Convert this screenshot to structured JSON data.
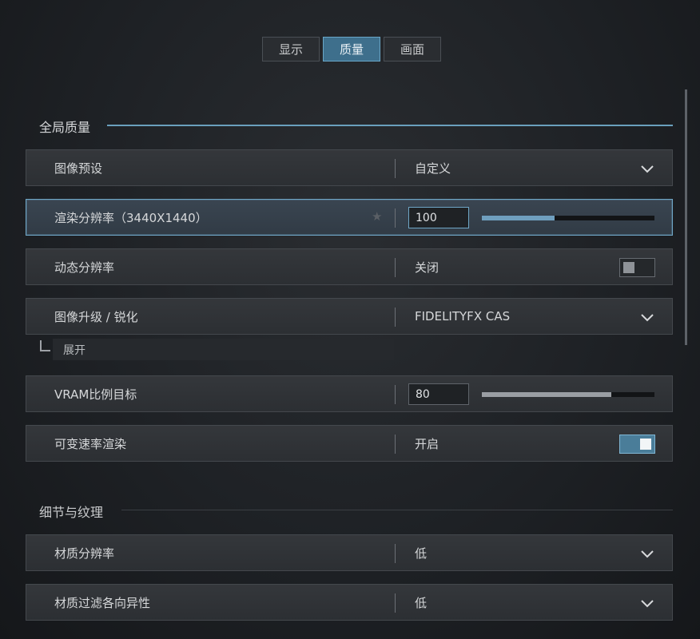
{
  "tabs": [
    {
      "label": "显示",
      "active": false
    },
    {
      "label": "质量",
      "active": true
    },
    {
      "label": "画面",
      "active": false
    }
  ],
  "sections": {
    "global_quality": {
      "title": "全局质量"
    },
    "detail_texture": {
      "title": "细节与纹理"
    }
  },
  "rows": {
    "image_preset": {
      "label": "图像预设",
      "value": "自定义",
      "control": "dropdown"
    },
    "render_resolution": {
      "label": "渲染分辨率（3440X1440）",
      "value": "100",
      "slider_fraction": 0.42,
      "control": "slider",
      "selected": true
    },
    "dynamic_resolution": {
      "label": "动态分辨率",
      "value": "关闭",
      "control": "toggle",
      "toggle_on": false
    },
    "upscaling": {
      "label": "图像升级 / 锐化",
      "value": "FIDELITYFX CAS",
      "control": "dropdown"
    },
    "upscaling_expand": {
      "label": "展开"
    },
    "vram_target": {
      "label": "VRAM比例目标",
      "value": "80",
      "slider_fraction": 0.75,
      "control": "slider"
    },
    "vrs": {
      "label": "可变速率渲染",
      "value": "开启",
      "control": "toggle",
      "toggle_on": true
    },
    "texture_resolution": {
      "label": "材质分辨率",
      "value": "低",
      "control": "dropdown"
    },
    "texture_filtering": {
      "label": "材质过滤各向异性",
      "value": "低",
      "control": "dropdown"
    }
  },
  "icons": {
    "chevron": "chevron-down-icon",
    "star": "star-icon",
    "branch": "tree-branch-icon"
  },
  "colors": {
    "accent": "#6aa0bd",
    "active_tab": "#3e6f8c",
    "slider_fill_active": "#6f9fbe",
    "slider_fill": "#9a9ea3",
    "toggle_on": "#4a7d99"
  }
}
